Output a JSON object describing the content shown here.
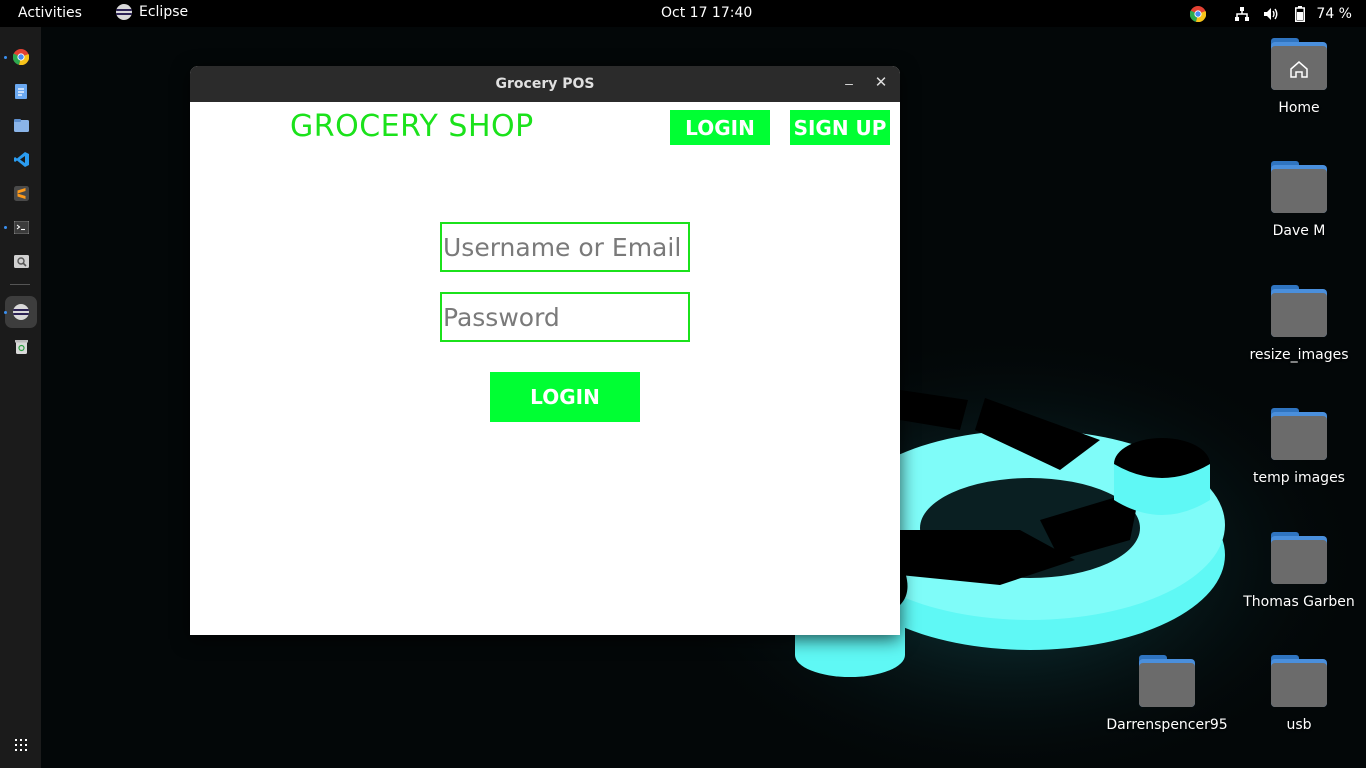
{
  "topbar": {
    "activities": "Activities",
    "app_name": "Eclipse",
    "clock": "Oct 17  17:40",
    "battery": "74 %"
  },
  "dock": {
    "items": [
      {
        "name": "chrome",
        "icon": "chrome-icon"
      },
      {
        "name": "text-editor",
        "icon": "document-icon"
      },
      {
        "name": "files",
        "icon": "files-icon"
      },
      {
        "name": "vscode",
        "icon": "vscode-icon"
      },
      {
        "name": "sublime-text",
        "icon": "sublime-icon"
      },
      {
        "name": "terminal",
        "icon": "terminal-icon"
      },
      {
        "name": "image-viewer",
        "icon": "magnifier-icon"
      },
      {
        "name": "eclipse",
        "icon": "eclipse-icon"
      },
      {
        "name": "trash",
        "icon": "trash-icon"
      },
      {
        "name": "app-grid",
        "icon": "grid-icon"
      }
    ]
  },
  "desktop": {
    "icons": [
      {
        "label": "Home",
        "icon": "home-folder-icon"
      },
      {
        "label": "Dave M",
        "icon": "folder-icon"
      },
      {
        "label": "resize_images",
        "icon": "folder-icon"
      },
      {
        "label": "temp images",
        "icon": "folder-icon"
      },
      {
        "label": "Thomas Garben",
        "icon": "folder-icon"
      },
      {
        "label": "Darrenspencer95",
        "icon": "folder-icon"
      },
      {
        "label": "usb",
        "icon": "folder-icon"
      }
    ]
  },
  "window": {
    "title": "Grocery POS",
    "minimize": "–",
    "close": "✕",
    "shop_title": "GROCERY SHOP",
    "nav_login": "LOGIN",
    "nav_signup": "SIGN UP",
    "username_placeholder": "Username or Email",
    "password_placeholder": "Password",
    "submit_label": "LOGIN"
  },
  "colors": {
    "accent_green": "#00ff33",
    "title_green": "#1be21b",
    "window_titlebar": "#2b2b2b",
    "topbar": "#000000",
    "dock": "#1b1b1b",
    "wallpaper_glow": "#5ff8f5"
  }
}
